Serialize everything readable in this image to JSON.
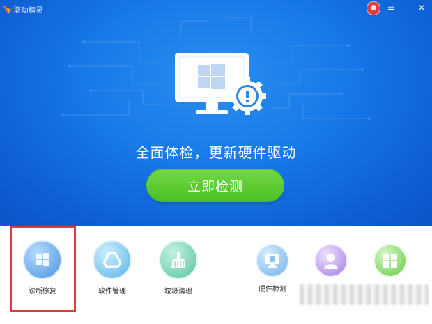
{
  "window": {
    "title": "驱动精灵",
    "controls": [
      "≡",
      "–",
      "×"
    ]
  },
  "hero": {
    "headline": "全面体检，更新硬件驱动",
    "scan_button": "立即检测"
  },
  "tools": [
    {
      "label": "诊断修复",
      "icon": "windows-icon"
    },
    {
      "label": "软件管理",
      "icon": "triangle-drive-icon"
    },
    {
      "label": "垃圾清理",
      "icon": "broom-icon"
    },
    {
      "label": "硬件检测",
      "icon": "monitor-chip-icon"
    },
    {
      "label": "",
      "icon": "person-icon"
    },
    {
      "label": "",
      "icon": "grid-icon"
    }
  ],
  "colors": {
    "hero_blue": "#1677e6",
    "button_green": "#56c72c",
    "highlight_red": "#e23a3a"
  }
}
